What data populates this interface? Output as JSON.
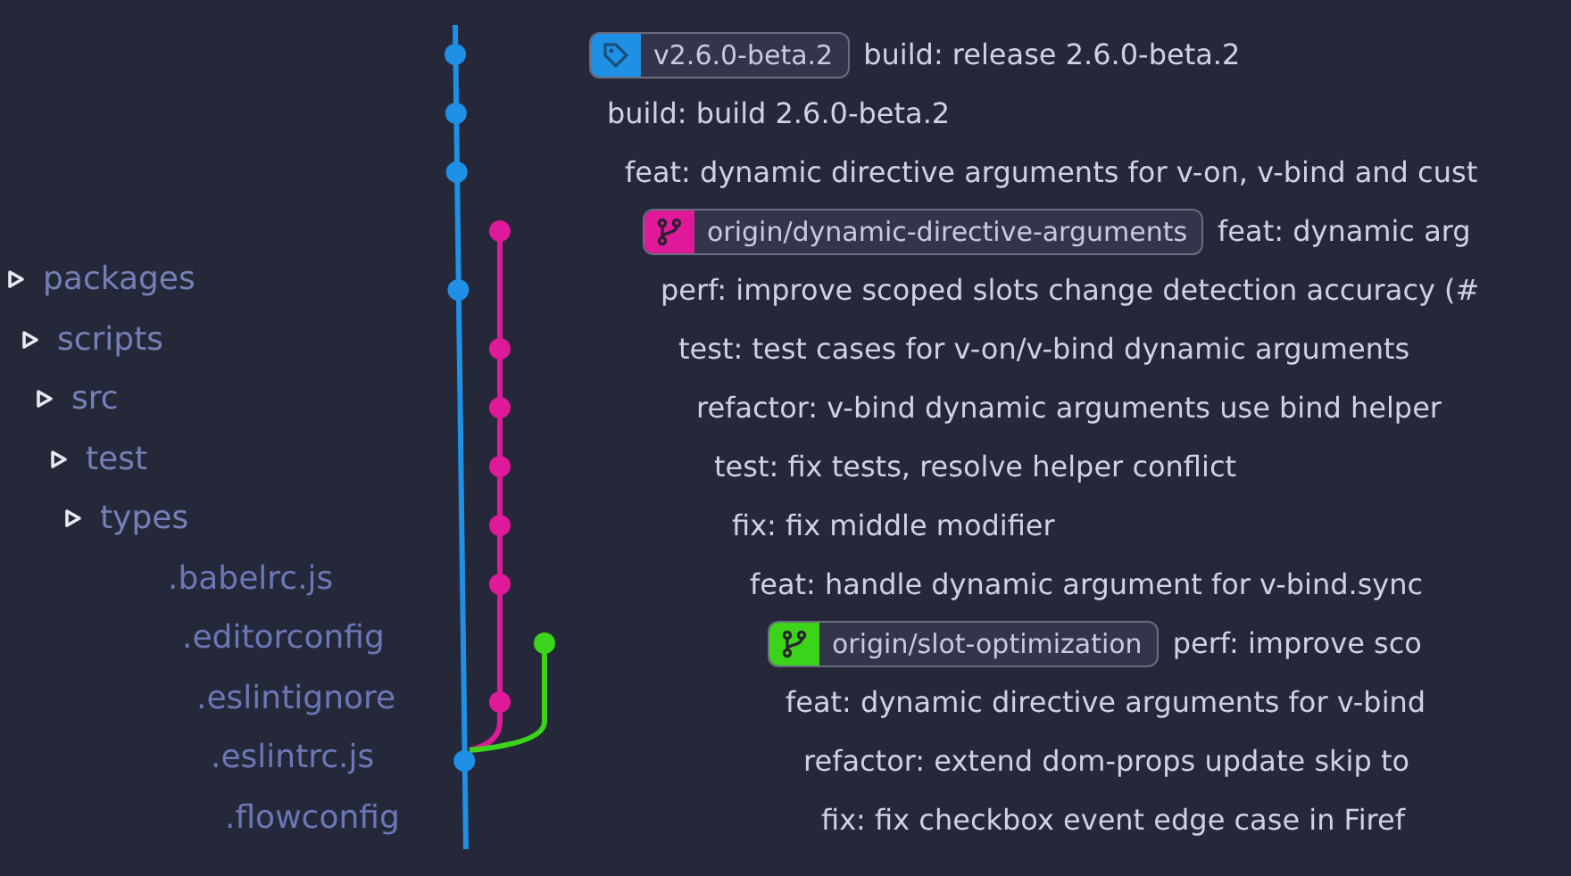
{
  "sidebar": {
    "items": [
      {
        "kind": "folder",
        "label": "packages"
      },
      {
        "kind": "folder",
        "label": "scripts"
      },
      {
        "kind": "folder",
        "label": "src"
      },
      {
        "kind": "folder",
        "label": "test"
      },
      {
        "kind": "folder",
        "label": "types"
      },
      {
        "kind": "file",
        "label": ".babelrc.js"
      },
      {
        "kind": "file",
        "label": ".editorconfig"
      },
      {
        "kind": "file",
        "label": ".eslintignore"
      },
      {
        "kind": "file",
        "label": ".eslintrc.js"
      },
      {
        "kind": "file",
        "label": ".flowconfig"
      }
    ]
  },
  "commits": [
    {
      "color": "#1e90e6",
      "tag": {
        "kind": "tag",
        "label": "v2.6.0-beta.2",
        "color": "#1e90e6"
      },
      "message": "build: release 2.6.0-beta.2"
    },
    {
      "color": "#1e90e6",
      "message": "build: build 2.6.0-beta.2"
    },
    {
      "color": "#1e90e6",
      "message": "feat: dynamic directive arguments for v-on, v-bind and cust"
    },
    {
      "color": "#e0199a",
      "tag": {
        "kind": "branch",
        "label": "origin/dynamic-directive-arguments",
        "color": "#e0199a"
      },
      "message": "feat: dynamic arg"
    },
    {
      "color": "#1e90e6",
      "message": "perf: improve scoped slots change detection accuracy (#"
    },
    {
      "color": "#e0199a",
      "message": "test: test cases for v-on/v-bind dynamic arguments"
    },
    {
      "color": "#e0199a",
      "message": "refactor: v-bind dynamic arguments use bind helper"
    },
    {
      "color": "#e0199a",
      "message": "test: fix tests, resolve helper conflict"
    },
    {
      "color": "#e0199a",
      "message": "fix: fix middle modifier"
    },
    {
      "color": "#e0199a",
      "message": "feat: handle dynamic argument for v-bind.sync"
    },
    {
      "color": "#3bd41a",
      "tag": {
        "kind": "branch",
        "label": "origin/slot-optimization",
        "color": "#3bd41a"
      },
      "message": "perf: improve sco"
    },
    {
      "color": "#e0199a",
      "message": "feat: dynamic directive arguments for v-bind"
    },
    {
      "color": "#1e90e6",
      "message": "refactor: extend dom-props update skip to"
    },
    {
      "message": "fix: fix checkbox event edge case in Firef"
    }
  ]
}
